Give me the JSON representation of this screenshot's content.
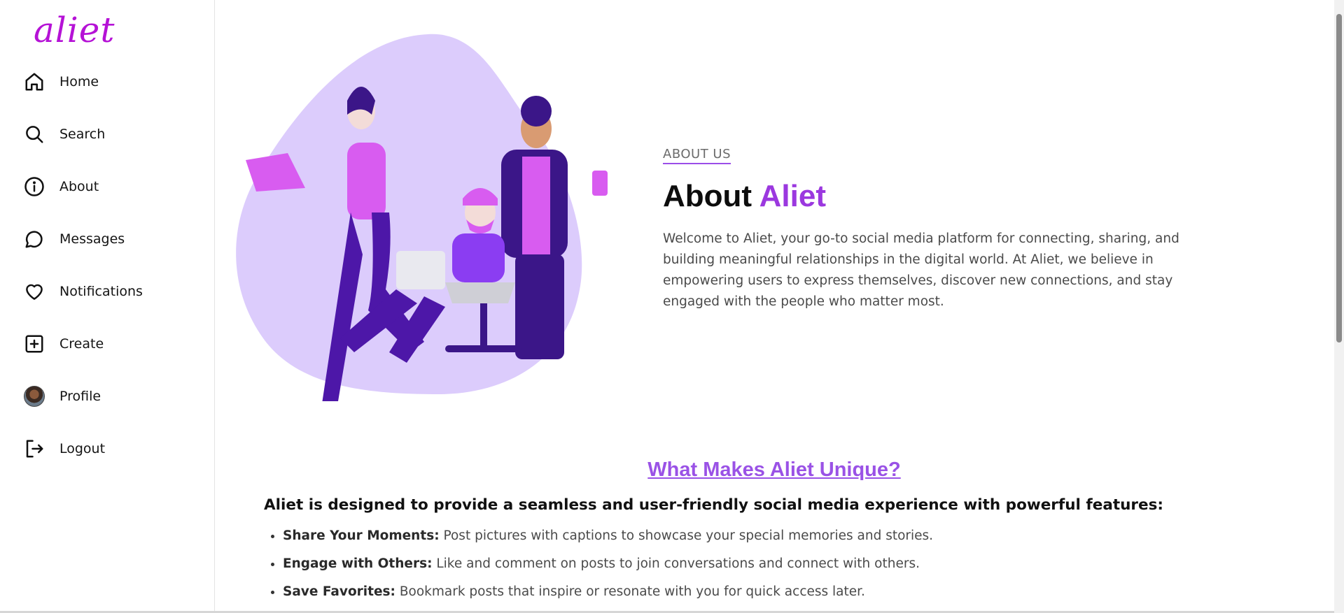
{
  "app": {
    "logo_text": "aliet",
    "brand_color": "#b512d6",
    "accent_color": "#9b38df"
  },
  "sidebar": {
    "items": [
      {
        "label": "Home",
        "icon": "home-icon"
      },
      {
        "label": "Search",
        "icon": "search-icon"
      },
      {
        "label": "About",
        "icon": "info-icon"
      },
      {
        "label": "Messages",
        "icon": "message-icon"
      },
      {
        "label": "Notifications",
        "icon": "heart-icon"
      },
      {
        "label": "Create",
        "icon": "plus-square-icon"
      },
      {
        "label": "Profile",
        "icon": "avatar"
      },
      {
        "label": "Logout",
        "icon": "logout-icon"
      }
    ]
  },
  "about": {
    "kicker": "ABOUT US",
    "title_prefix": "About",
    "title_accent": "Aliet",
    "description": "Welcome to Aliet, your go-to social media platform for connecting, sharing, and building meaningful relationships in the digital world. At Aliet, we believe in empowering users to express themselves, discover new connections, and stay engaged with the people who matter most."
  },
  "unique": {
    "heading": "What Makes Aliet Unique?",
    "subheading": "Aliet is designed to provide a seamless and user-friendly social media experience with powerful features:",
    "features": [
      {
        "title": "Share Your Moments:",
        "text": " Post pictures with captions to showcase your special memories and stories."
      },
      {
        "title": "Engage with Others:",
        "text": " Like and comment on posts to join conversations and connect with others."
      },
      {
        "title": "Save Favorites:",
        "text": " Bookmark posts that inspire or resonate with you for quick access later."
      }
    ]
  }
}
